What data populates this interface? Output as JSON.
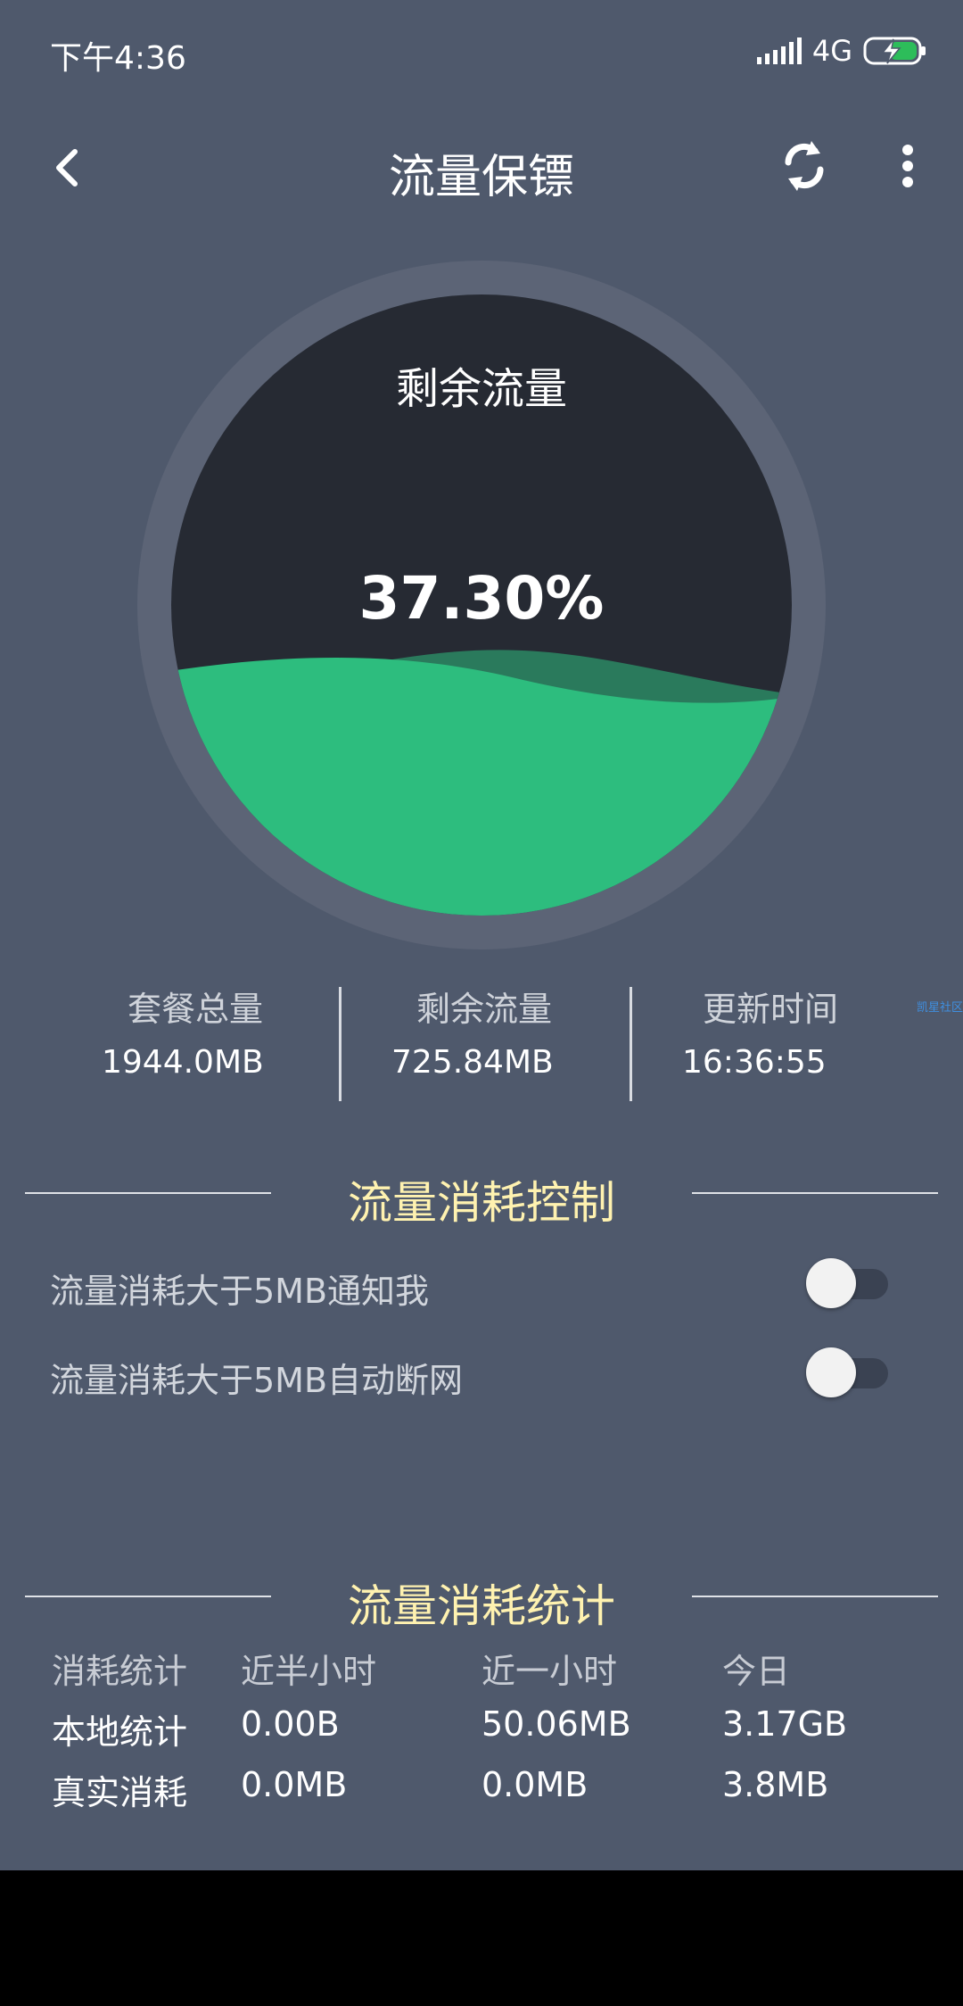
{
  "status_bar": {
    "time": "下午4:36",
    "network": "4G",
    "signal_icon": "signal-icon",
    "battery_icon": "battery-charging-icon"
  },
  "app_bar": {
    "title": "流量保镖",
    "back_icon": "chevron-left-icon",
    "refresh_icon": "refresh-icon",
    "more_icon": "more-vertical-icon"
  },
  "gauge": {
    "label": "剩余流量",
    "percent_text": "37.30%",
    "fill_fraction": 0.373,
    "colors": {
      "ring": "#5c6476",
      "inner": "#262a33",
      "wave_front": "#2dbd7e",
      "wave_back": "#2a7a5c"
    }
  },
  "summary": [
    {
      "label": "套餐总量",
      "value": "1944.0MB"
    },
    {
      "label": "剩余流量",
      "value": "725.84MB"
    },
    {
      "label": "更新时间",
      "value": "16:36:55"
    }
  ],
  "watermark": "凯星社区",
  "control_section": {
    "title": "流量消耗控制",
    "items": [
      {
        "label": "流量消耗大于5MB通知我",
        "on": false
      },
      {
        "label": "流量消耗大于5MB自动断网",
        "on": false
      }
    ]
  },
  "stats_section": {
    "title": "流量消耗统计",
    "headers": [
      "消耗统计",
      "近半小时",
      "近一小时",
      "今日"
    ],
    "rows": [
      [
        "本地统计",
        "0.00B",
        "50.06MB",
        "3.17GB"
      ],
      [
        "真实消耗",
        "0.0MB",
        "0.0MB",
        "3.8MB"
      ]
    ]
  },
  "colors": {
    "background": "#4f596c",
    "section_title": "#fff2b0",
    "accent_green": "#2dbd7e"
  }
}
